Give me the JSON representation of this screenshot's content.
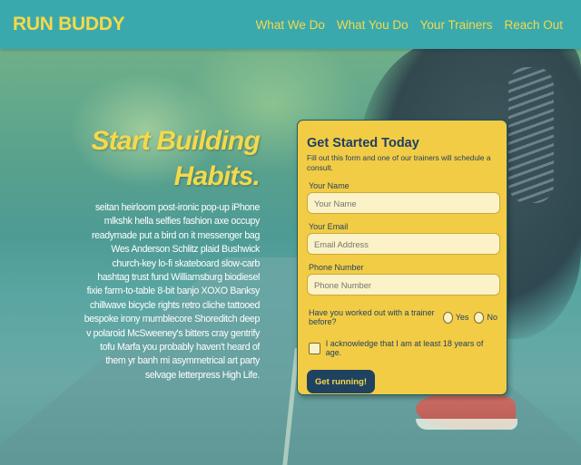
{
  "header": {
    "brand": "RUN BUDDY",
    "nav": [
      "What We Do",
      "What You Do",
      "Your Trainers",
      "Reach Out"
    ]
  },
  "hero": {
    "headline_line1": "Start Building",
    "headline_line2": "Habits.",
    "body": "seitan heirloom post-ironic pop-up iPhone mlkshk hella selfies fashion axe occupy readymade put a bird on it messenger bag Wes Anderson Schlitz plaid Bushwick church-key lo-fi skateboard slow-carb hashtag trust fund Williamsburg biodiesel fixie farm-to-table 8-bit banjo XOXO Banksy chillwave bicycle rights retro cliche tattooed bespoke irony mumblecore Shoreditch deep v polaroid McSweeney's bitters cray gentrify tofu Marfa you probably haven't heard of them yr banh mi asymmetrical art party selvage letterpress High Life."
  },
  "form": {
    "title": "Get Started Today",
    "subtitle": "Fill out this form and one of our trainers will schedule a consult.",
    "name_label": "Your Name",
    "name_placeholder": "Your Name",
    "email_label": "Your Email",
    "email_placeholder": "Email Address",
    "phone_label": "Phone Number",
    "phone_placeholder": "Phone Number",
    "trainer_question": "Have you worked out with a trainer before?",
    "yes_label": "Yes",
    "no_label": "No",
    "age_ack": "I acknowledge that I am at least 18 years of age.",
    "submit_label": "Get running!"
  },
  "colors": {
    "header_bg": "#3aa9ad",
    "accent_yellow": "#f5d94a",
    "card_bg": "#f2cc45",
    "navy": "#1f4261"
  }
}
